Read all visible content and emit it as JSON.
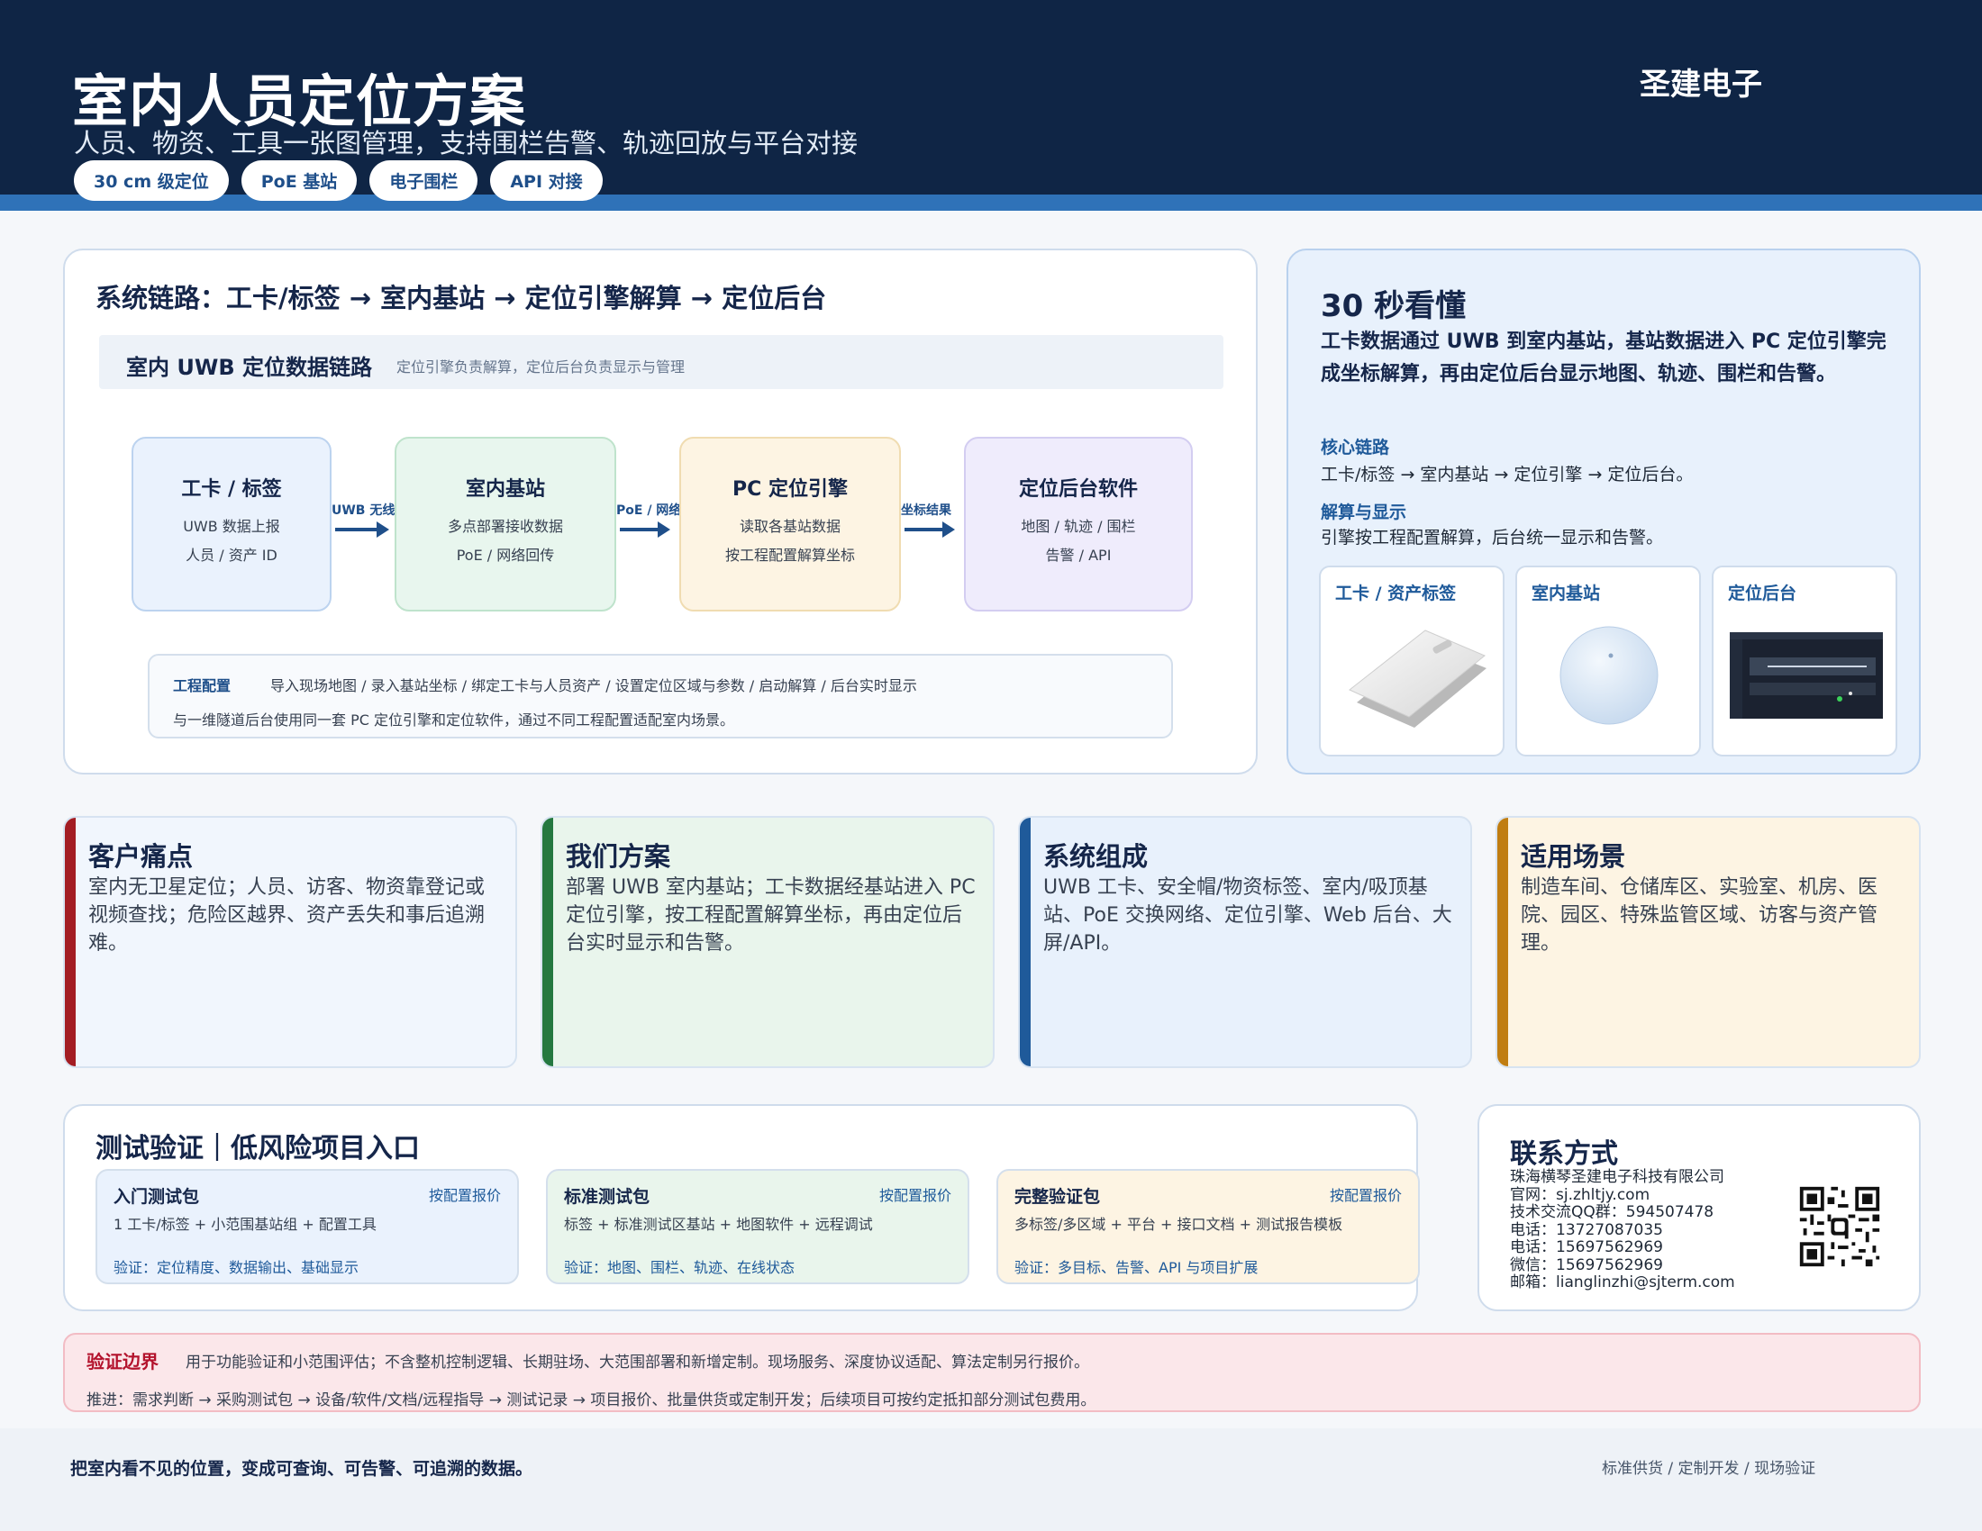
{
  "header": {
    "title": "室内人员定位方案",
    "subtitle": "人员、物资、工具一张图管理，支持围栏告警、轨迹回放与平台对接",
    "brand": "圣建电子",
    "tags": [
      "30 cm 级定位",
      "PoE 基站",
      "电子围栏",
      "API 对接"
    ]
  },
  "flow": {
    "title": "系统链路：工卡/标签 → 室内基站 → 定位引擎解算 → 定位后台",
    "band_title": "室内 UWB 定位数据链路",
    "band_note": "定位引擎负责解算，定位后台负责显示与管理",
    "nodes": [
      {
        "title": "工卡 / 标签",
        "line1": "UWB 数据上报",
        "line2": "人员 / 资产 ID",
        "bg": "#eaf2fd",
        "border": "#bcd3ef"
      },
      {
        "title": "室内基站",
        "line1": "多点部署接收数据",
        "line2": "PoE / 网络回传",
        "bg": "#e8f6ee",
        "border": "#bfe3cc"
      },
      {
        "title": "PC 定位引擎",
        "line1": "读取各基站数据",
        "line2": "按工程配置解算坐标",
        "bg": "#fdf4e3",
        "border": "#f0dcb1"
      },
      {
        "title": "定位后台软件",
        "line1": "地图 / 轨迹 / 围栏",
        "line2": "告警 / API",
        "bg": "#efecfc",
        "border": "#d3cdf1"
      }
    ],
    "arrows": [
      "UWB 无线",
      "PoE / 网络",
      "坐标结果"
    ],
    "config_label": "工程配置",
    "config_steps": "导入现场地图 / 录入基站坐标 / 绑定工卡与人员资产 / 设置定位区域与参数 / 启动解算 / 后台实时显示",
    "config_note": "与一维隧道后台使用同一套 PC 定位引擎和定位软件，通过不同工程配置适配室内场景。"
  },
  "summary": {
    "title": "30 秒看懂",
    "text": "工卡数据通过 UWB 到室内基站，基站数据进入 PC 定位引擎完成坐标解算，再由定位后台显示地图、轨迹、围栏和告警。",
    "items": [
      {
        "k": "核心链路",
        "v": "工卡/标签 → 室内基站 → 定位引擎 → 定位后台。"
      },
      {
        "k": "解算与显示",
        "v": "引擎按工程配置解算，后台统一显示和告警。"
      }
    ],
    "photos": [
      "工卡 / 资产标签",
      "室内基站",
      "定位后台"
    ]
  },
  "cards": [
    {
      "title": "客户痛点",
      "text": "室内无卫星定位；人员、访客、物资靠登记或视频查找；危险区越界、资产丢失和事后追溯难。",
      "color": "#a31d23",
      "bg": "#f1f6fd"
    },
    {
      "title": "我们方案",
      "text": "部署 UWB 室内基站；工卡数据经基站进入 PC 定位引擎，按工程配置解算坐标，再由定位后台实时显示和告警。",
      "color": "#247840",
      "bg": "#e9f5ec"
    },
    {
      "title": "系统组成",
      "text": "UWB 工卡、安全帽/物资标签、室内/吸顶基站、PoE 交换网络、定位引擎、Web 后台、大屏/API。",
      "color": "#1f5a9a",
      "bg": "#e8f1fc"
    },
    {
      "title": "适用场景",
      "text": "制造车间、仓储库区、实验室、机房、医院、园区、特殊监管区域、访客与资产管理。",
      "color": "#c07d12",
      "bg": "#fdf4e3"
    }
  ],
  "test": {
    "title": "测试验证｜低风险项目入口",
    "packs": [
      {
        "name": "入门测试包",
        "price": "按配置报价",
        "desc": "1 工卡/标签 + 小范围基站组 + 配置工具",
        "verify": "验证：定位精度、数据输出、基础显示",
        "bg": "#eaf2fd"
      },
      {
        "name": "标准测试包",
        "price": "按配置报价",
        "desc": "标签 + 标准测试区基站 + 地图软件 + 远程调试",
        "verify": "验证：地图、围栏、轨迹、在线状态",
        "bg": "#e9f5ec"
      },
      {
        "name": "完整验证包",
        "price": "按配置报价",
        "desc": "多标签/多区域 + 平台 + 接口文档 + 测试报告模板",
        "verify": "验证：多目标、告警、API 与项目扩展",
        "bg": "#fdf4e3"
      }
    ]
  },
  "contact": {
    "title": "联系方式",
    "lines": [
      "珠海横琴圣建电子科技有限公司",
      "官网：sj.zhltjy.com",
      "技术交流QQ群：594507478",
      "电话：13727087035",
      "电话：15697562969",
      "微信：15697562969",
      "邮箱：lianglinzhi@sjterm.com"
    ]
  },
  "boundary": {
    "label": "验证边界",
    "text": "用于功能验证和小范围评估；不含整机控制逻辑、长期驻场、大范围部署和新增定制。现场服务、深度协议适配、算法定制另行报价。",
    "path": "推进：需求判断 → 采购测试包 → 设备/软件/文档/远程指导 → 测试记录 → 项目报价、批量供货或定制开发；后续项目可按约定抵扣部分测试包费用。"
  },
  "footer": {
    "left": "把室内看不见的位置，变成可查询、可告警、可追溯的数据。",
    "right": "标准供货 / 定制开发 / 现场验证"
  }
}
